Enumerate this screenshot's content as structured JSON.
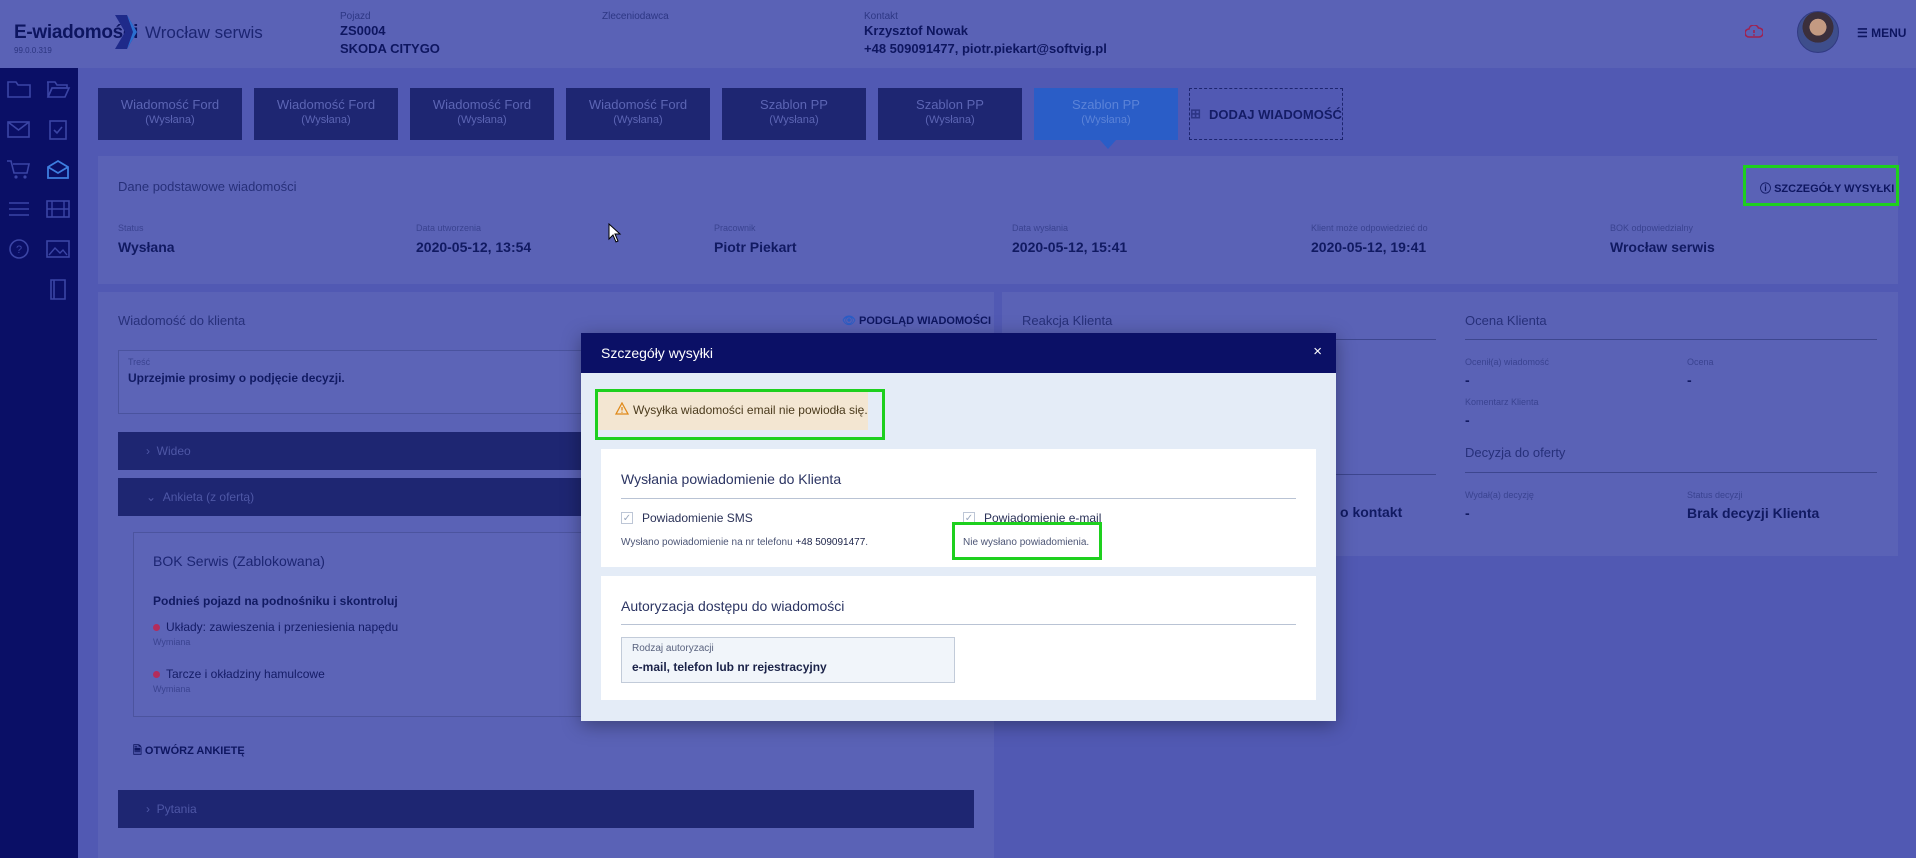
{
  "header": {
    "app_name": "E-wiadomości",
    "version": "99.0.0.319",
    "site": "Wrocław serwis",
    "vehicle_label": "Pojazd",
    "vehicle_id": "ZS0004",
    "vehicle_model": "SKODA CITYGO",
    "client_label": "Zleceniodawca",
    "contact_label": "Kontakt",
    "contact_name": "Krzysztof Nowak",
    "contact_details": "+48 509091477, piotr.piekart@softvig.pl",
    "menu_label": "MENU"
  },
  "tabs": [
    {
      "title": "Wiadomość Ford",
      "status": "(Wysłana)"
    },
    {
      "title": "Wiadomość Ford",
      "status": "(Wysłana)"
    },
    {
      "title": "Wiadomość Ford",
      "status": "(Wysłana)"
    },
    {
      "title": "Wiadomość Ford",
      "status": "(Wysłana)"
    },
    {
      "title": "Szablon PP",
      "status": "(Wysłana)"
    },
    {
      "title": "Szablon PP",
      "status": "(Wysłana)"
    },
    {
      "title": "Szablon PP",
      "status": "(Wysłana)"
    }
  ],
  "add_message_label": "DODAJ WIADOMOŚĆ",
  "basic": {
    "title": "Dane podstawowe wiadomości",
    "details_link": "SZCZEGÓŁY WYSYŁKI",
    "fields": [
      {
        "label": "Status",
        "value": "Wysłana"
      },
      {
        "label": "Data utworzenia",
        "value": "2020-05-12, 13:54"
      },
      {
        "label": "Pracownik",
        "value": "Piotr Piekart"
      },
      {
        "label": "Data wysłania",
        "value": "2020-05-12, 15:41"
      },
      {
        "label": "Klient może odpowiedzieć do",
        "value": "2020-05-12, 19:41"
      },
      {
        "label": "BOK odpowiedzialny",
        "value": "Wrocław serwis"
      }
    ]
  },
  "message": {
    "title": "Wiadomość do klienta",
    "preview_link": "PODGLĄD WIADOMOŚCI",
    "content_label": "Treść",
    "content": "Uprzejmie prosimy o podjęcie decyzji.",
    "video_label": "Wideo",
    "survey_label": "Ankieta (z ofertą)",
    "survey_box_title": "BOK Serwis (Zablokowana)",
    "survey_heading": "Podnieś pojazd na podnośniku i skontroluj",
    "items": [
      {
        "name": "Układy: zawieszenia i przeniesienia napędu",
        "status": "Wymiana"
      },
      {
        "name": "Tarcze i okładziny hamulcowe",
        "status": "Wymiana"
      }
    ],
    "open_survey": "OTWÓRZ ANKIETĘ",
    "questions_label": "Pytania"
  },
  "reaction": {
    "title": "Reakcja Klienta",
    "partial_text": "o kontakt"
  },
  "rating": {
    "title": "Ocena Klienta",
    "rated_label": "Ocenił(a) wiadomość",
    "rated_value": "-",
    "score_label": "Ocena",
    "score_value": "-",
    "comment_label": "Komentarz Klienta",
    "comment_value": "-",
    "decision_title": "Decyzja do oferty",
    "decided_label": "Wydał(a) decyzję",
    "decided_value": "-",
    "decision_status_label": "Status decyzji",
    "decision_status_value": "Brak decyzji Klienta"
  },
  "modal": {
    "title": "Szczegóły wysyłki",
    "close": "×",
    "warning": "Wysyłka wiadomości email nie powiodła się.",
    "notify_title": "Wysłania powiadomienie do Klienta",
    "sms_label": "Powiadomienie SMS",
    "sms_info_prefix": "Wysłano powiadomienie na nr telefonu",
    "sms_phone": "+48 509091477",
    "email_label": "Powiadomienie e-mail",
    "email_info": "Nie wysłano powiadomienia.",
    "auth_title": "Autoryzacja dostępu do wiadomości",
    "auth_field_label": "Rodzaj autoryzacji",
    "auth_field_value": "e-mail, telefon lub nr rejestracyjny"
  },
  "colors": {
    "highlight": "#1ed01e",
    "modal_header": "#0b1066",
    "warning_bg": "#f3e6d2",
    "active_tab": "#2a5dc7"
  }
}
